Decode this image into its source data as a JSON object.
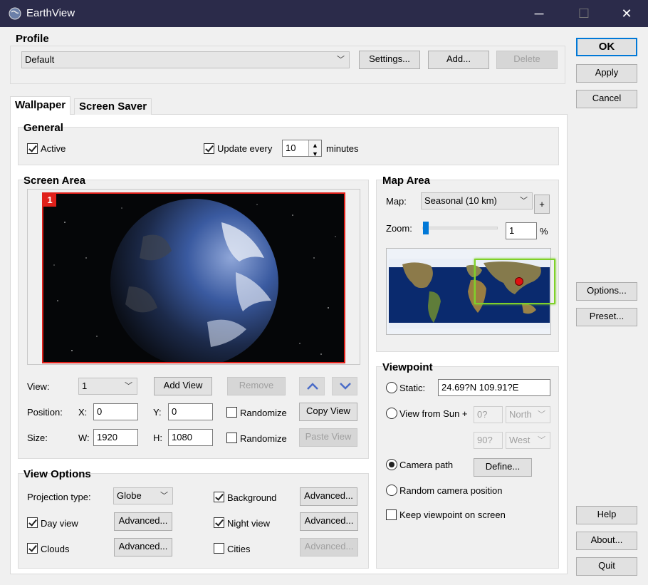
{
  "window": {
    "title": "EarthView",
    "min_icon": "minimize-icon",
    "max_icon": "maximize-icon",
    "close_icon": "close-icon"
  },
  "profile": {
    "heading": "Profile",
    "selected": "Default",
    "settings_label": "Settings...",
    "add_label": "Add...",
    "delete_label": "Delete"
  },
  "right_buttons": {
    "ok": "OK",
    "apply": "Apply",
    "cancel": "Cancel",
    "options": "Options...",
    "preset": "Preset...",
    "help": "Help",
    "about": "About...",
    "quit": "Quit"
  },
  "tabs": [
    {
      "label": "Wallpaper"
    },
    {
      "label": "Screen Saver"
    }
  ],
  "general": {
    "heading": "General",
    "active_label": "Active",
    "active_checked": true,
    "update_label": "Update every",
    "update_checked": true,
    "update_value": "10",
    "minutes_label": "minutes"
  },
  "screen_area": {
    "heading": "Screen Area",
    "monitor_badge": "1",
    "view_label": "View:",
    "view_value": "1",
    "add_view": "Add View",
    "remove": "Remove",
    "position_label": "Position:",
    "x_label": "X:",
    "x_value": "0",
    "y_label": "Y:",
    "y_value": "0",
    "randomize1": "Randomize",
    "copy_view": "Copy View",
    "size_label": "Size:",
    "w_label": "W:",
    "w_value": "1920",
    "h_label": "H:",
    "h_value": "1080",
    "randomize2": "Randomize",
    "paste_view": "Paste View",
    "up_icon": "chevron-up-icon",
    "down_icon": "chevron-down-icon"
  },
  "view_options": {
    "heading": "View Options",
    "projection_label": "Projection type:",
    "projection_value": "Globe",
    "background_label": "Background",
    "background_checked": true,
    "day_label": "Day view",
    "day_checked": true,
    "night_label": "Night view",
    "night_checked": true,
    "clouds_label": "Clouds",
    "clouds_checked": true,
    "cities_label": "Cities",
    "cities_checked": false,
    "advanced": "Advanced..."
  },
  "map_area": {
    "heading": "Map Area",
    "map_label": "Map:",
    "map_value": "Seasonal (10 km)",
    "plus_label": "+",
    "zoom_label": "Zoom:",
    "zoom_value": "1",
    "zoom_unit": "%",
    "zoom_fraction": 0.01
  },
  "viewpoint": {
    "heading": "Viewpoint",
    "static_label": "Static:",
    "static_value": "24.69?N   109.91?E",
    "from_sun_label": "View from Sun +",
    "sun_lat_value": "0?",
    "sun_lat_dir": "North",
    "sun_lon_value": "90?",
    "sun_lon_dir": "West",
    "camera_path_label": "Camera path",
    "define_label": "Define...",
    "random_label": "Random camera position",
    "keep_label": "Keep viewpoint on screen"
  },
  "colors": {
    "titlebar": "#2b2b4a",
    "accent": "#0078d7",
    "monitor_border": "#e0201a",
    "map_frame": "#7fd12a",
    "marker": "#e01010"
  }
}
